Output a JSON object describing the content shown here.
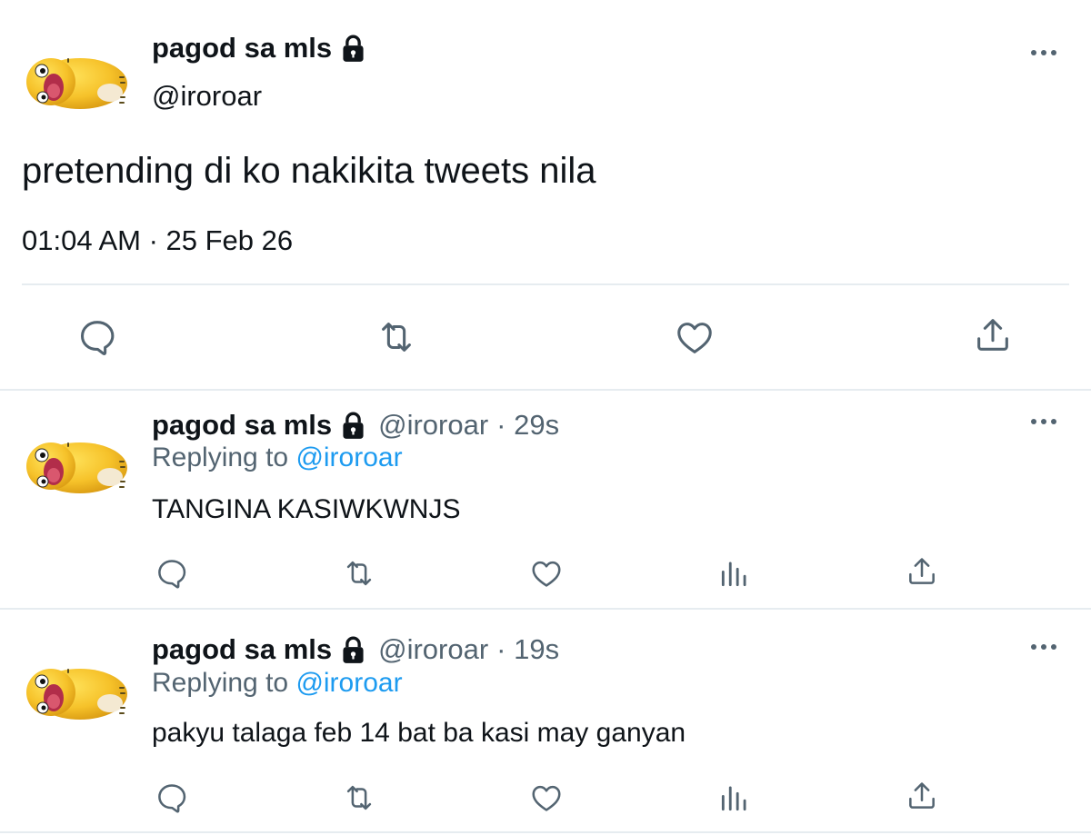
{
  "main_tweet": {
    "display_name": "pagod sa mls",
    "handle": "@iroroar",
    "text": "pretending di ko nakikita tweets nila",
    "timestamp": "01:04 AM · 25 Feb 26",
    "more_icon": "more-horizontal-icon",
    "protected_icon": "lock-icon"
  },
  "replies": [
    {
      "display_name": "pagod sa mls",
      "handle": "@iroroar",
      "time": "· 29s",
      "replying_prefix": "Replying to",
      "replying_to": "@iroroar",
      "text": "TANGINA KASIWKWNJS"
    },
    {
      "display_name": "pagod sa mls",
      "handle": "@iroroar",
      "time": "· 19s",
      "replying_prefix": "Replying to",
      "replying_to": "@iroroar",
      "text": "pakyu talaga feb 14 bat ba kasi may ganyan"
    }
  ],
  "colors": {
    "text_primary": "#0f1419",
    "text_secondary": "#536471",
    "link": "#1d9bf0",
    "divider": "#e6ecf0",
    "avatar": "#f7c531"
  },
  "icons": {
    "actions_main": [
      "reply-icon",
      "retweet-icon",
      "like-icon",
      "share-icon"
    ],
    "actions_reply": [
      "reply-icon",
      "retweet-icon",
      "like-icon",
      "views-icon",
      "share-icon"
    ]
  }
}
